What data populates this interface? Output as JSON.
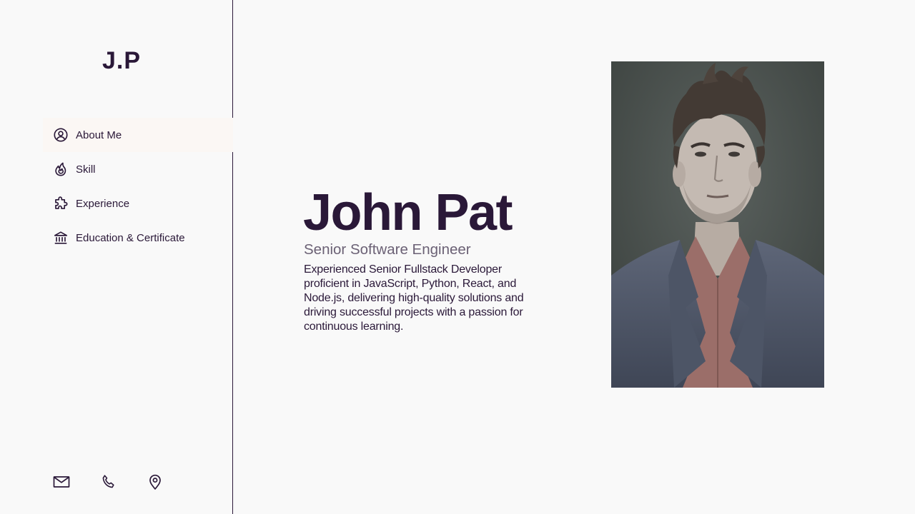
{
  "sidebar": {
    "logo": "J.P",
    "nav": [
      {
        "label": "About Me",
        "icon": "user-circle-icon",
        "active": true
      },
      {
        "label": "Skill",
        "icon": "flame-icon",
        "active": false
      },
      {
        "label": "Experience",
        "icon": "puzzle-icon",
        "active": false
      },
      {
        "label": "Education & Certificate",
        "icon": "bank-icon",
        "active": false
      }
    ],
    "contacts": [
      {
        "icon": "mail-icon"
      },
      {
        "icon": "phone-icon"
      },
      {
        "icon": "map-pin-icon"
      }
    ]
  },
  "hero": {
    "name": "John Pat",
    "role": "Senior Software Engineer",
    "bio": "Experienced Senior Fullstack Developer proficient in JavaScript, Python, React, and Node.js, delivering high-quality solutions and driving successful projects with a passion for continuous learning."
  },
  "colors": {
    "primary": "#2a1838",
    "muted": "#6b6175",
    "background": "#f9f9f9",
    "active_nav_bg": "#fbf7f4"
  }
}
